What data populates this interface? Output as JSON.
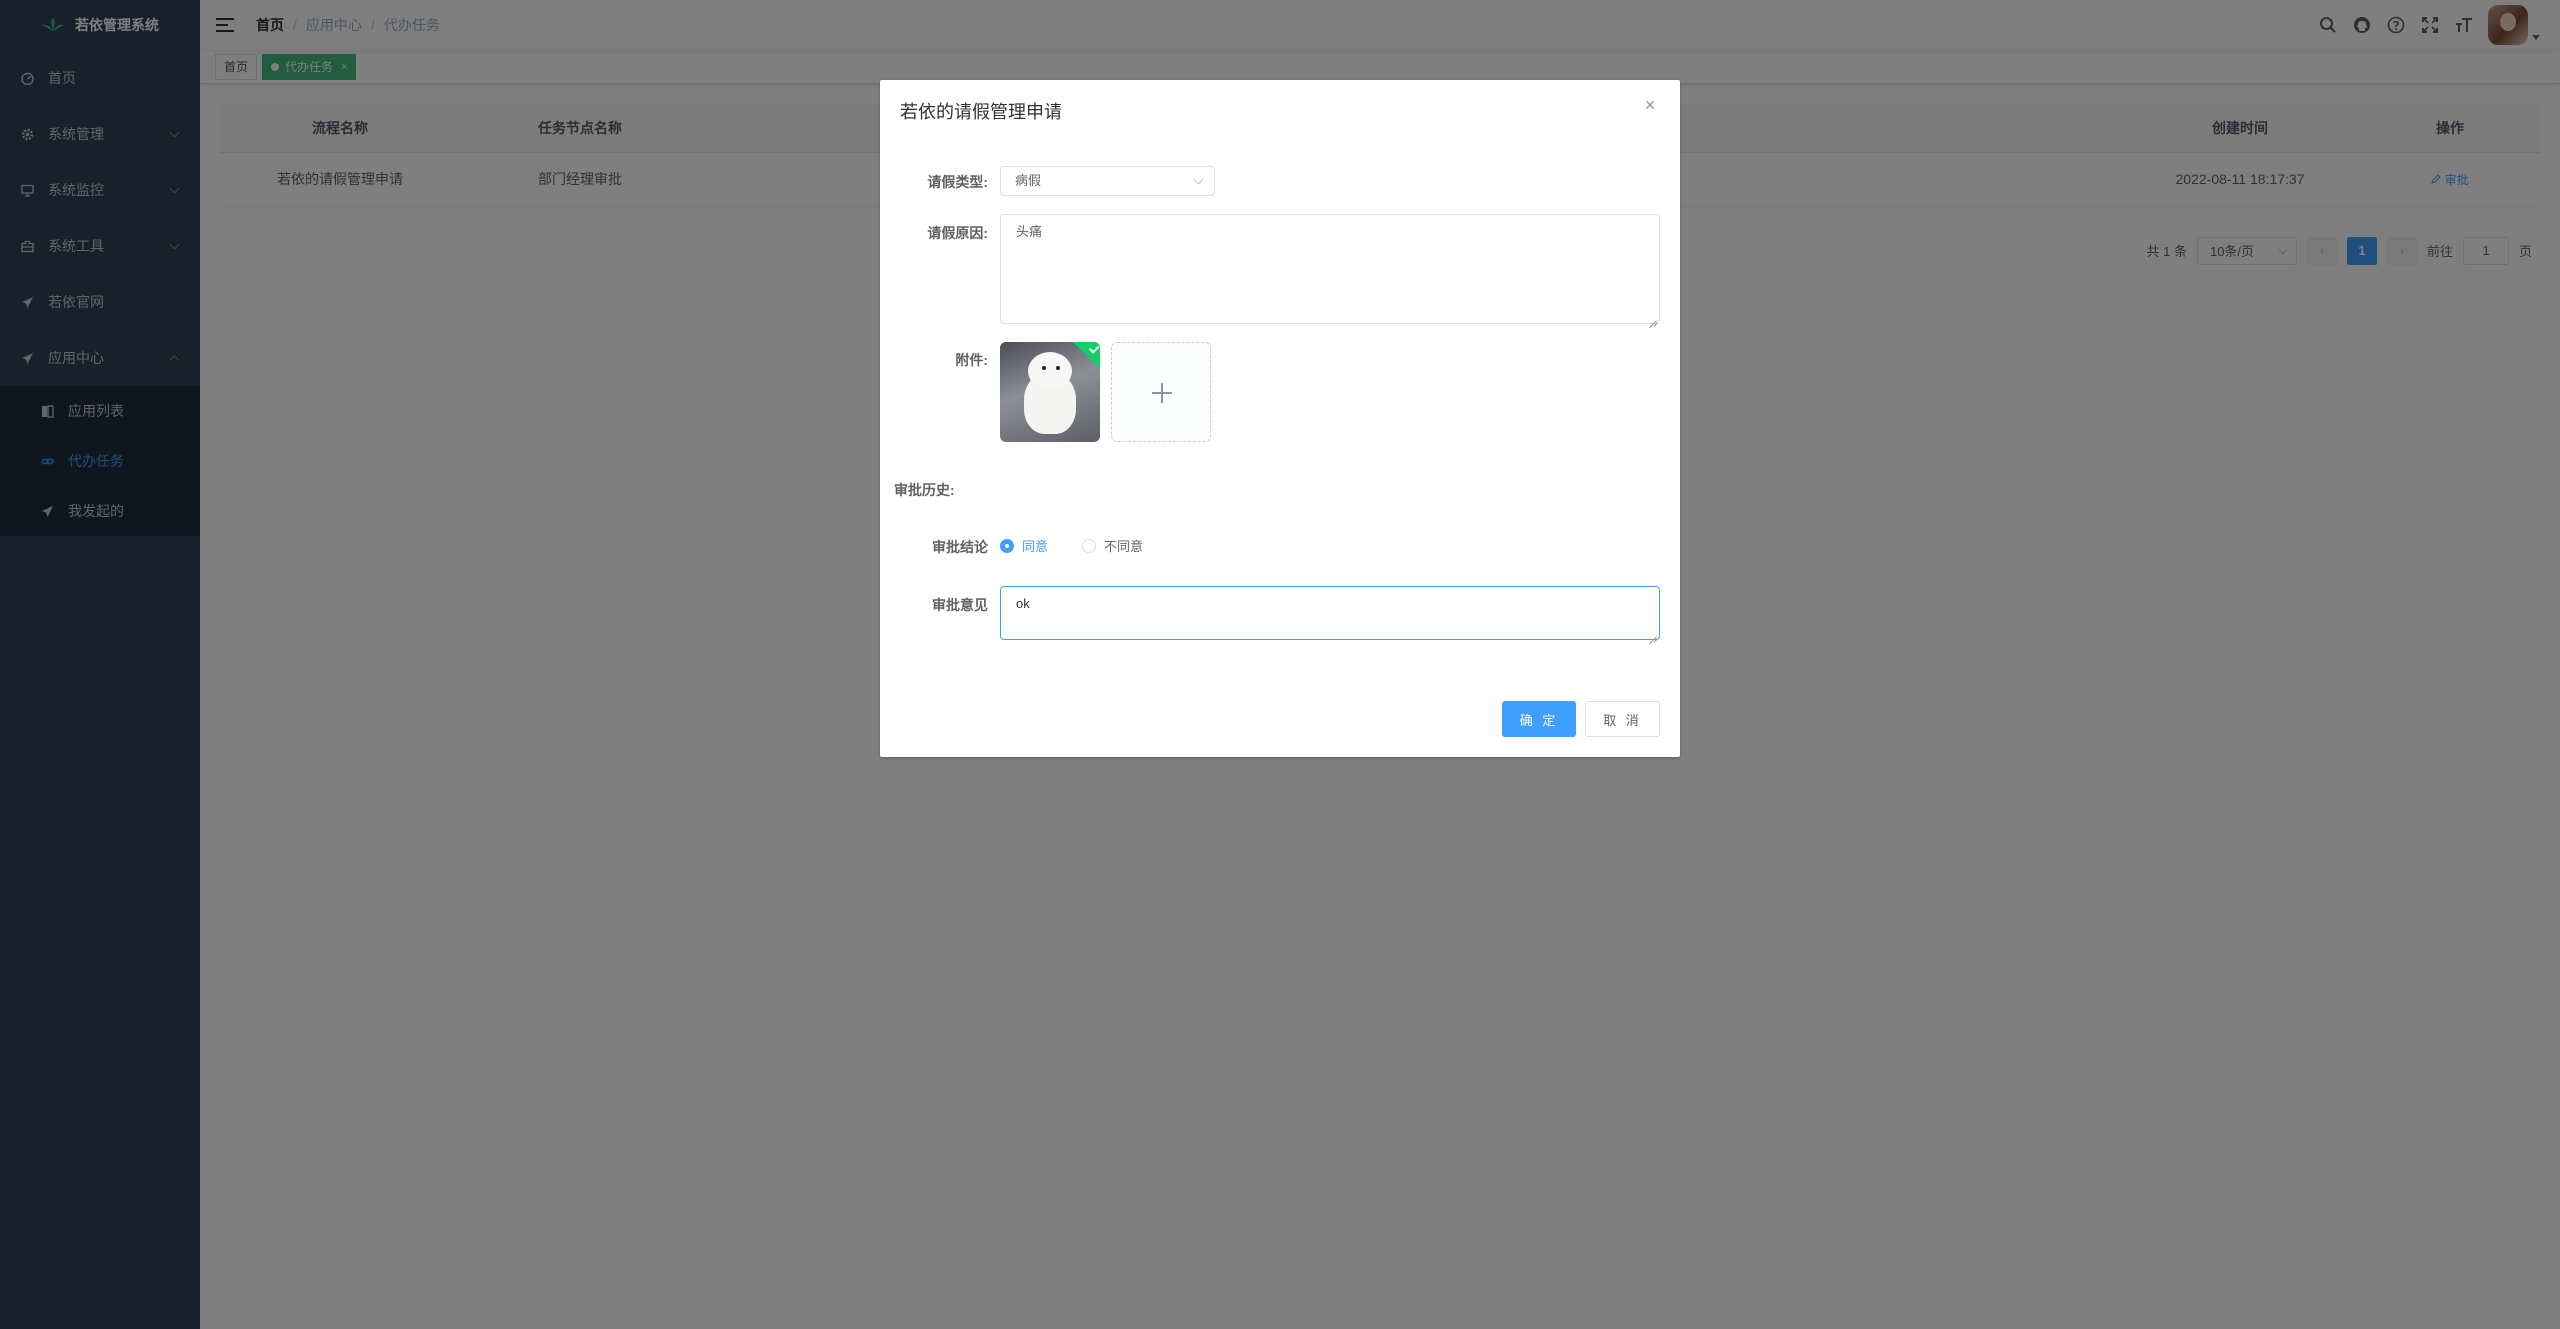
{
  "app": {
    "title": "若依管理系统"
  },
  "sidebar": {
    "items": [
      {
        "label": "首页",
        "icon": "dashboard-icon"
      },
      {
        "label": "系统管理",
        "icon": "gear-icon"
      },
      {
        "label": "系统监控",
        "icon": "monitor-icon"
      },
      {
        "label": "系统工具",
        "icon": "toolbox-icon"
      },
      {
        "label": "若依官网",
        "icon": "send-icon"
      },
      {
        "label": "应用中心",
        "icon": "send-icon"
      }
    ],
    "submenu": [
      {
        "label": "应用列表",
        "icon": "book-icon"
      },
      {
        "label": "代办任务",
        "icon": "link-icon"
      },
      {
        "label": "我发起的",
        "icon": "send-icon"
      }
    ]
  },
  "navbar": {
    "breadcrumb": [
      "首页",
      "应用中心",
      "代办任务"
    ]
  },
  "tags": {
    "home": "首页",
    "active": "代办任务",
    "close": "×"
  },
  "table": {
    "headers": {
      "process_name": "流程名称",
      "node_name": "任务节点名称",
      "create_time": "创建时间",
      "action": "操作"
    },
    "rows": [
      {
        "process_name": "若依的请假管理申请",
        "node_name": "部门经理审批",
        "create_time": "2022-08-11 18:17:37",
        "action": "审批"
      }
    ]
  },
  "pagination": {
    "total": "共 1 条",
    "page_size": "10条/页",
    "current": "1",
    "goto_label": "前往",
    "goto_value": "1",
    "page_suffix": "页"
  },
  "dialog": {
    "title": "若依的请假管理申请",
    "leave_type_label": "请假类型:",
    "leave_type_value": "病假",
    "reason_label": "请假原因:",
    "reason_value": "头痛",
    "attachment_label": "附件:",
    "history_label": "审批历史:",
    "conclusion_label": "审批结论",
    "option_agree": "同意",
    "option_disagree": "不同意",
    "opinion_label": "审批意见",
    "opinion_value": "ok",
    "confirm": "确 定",
    "cancel": "取 消"
  },
  "colors": {
    "sidebar_bg": "#304156",
    "submenu_bg": "#1f2d3d",
    "primary": "#409eff",
    "tag_active": "#42b983",
    "upload_success": "#13ce66"
  }
}
